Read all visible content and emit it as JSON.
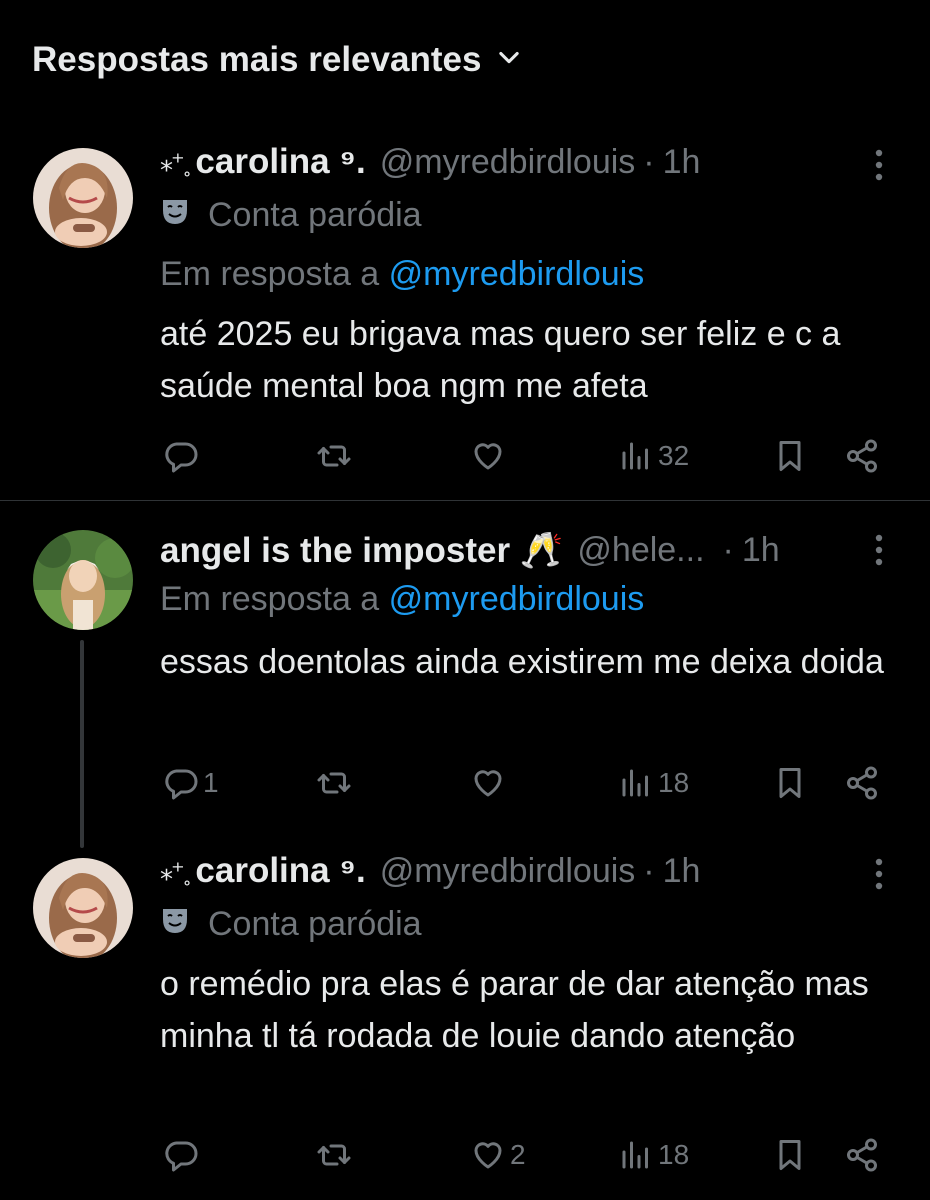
{
  "header": {
    "title": "Respostas mais relevantes"
  },
  "colors": {
    "background": "#000000",
    "text": "#e7e9ea",
    "muted": "#71767b",
    "link": "#1d9bf0",
    "divider": "#2f3336"
  },
  "tweets": [
    {
      "sparkle": "⁎⁺˳",
      "display_name": "carolina ⁹.",
      "handle": "@myredbirdlouis",
      "separator": "·",
      "time": "1h",
      "badge_icon": "theater-mask-icon",
      "badge_label": "Conta paródia",
      "reply_prefix": "Em resposta a",
      "reply_to": "@myredbirdlouis",
      "body": "até 2025 eu brigava mas quero ser feliz e c a saúde mental boa ngm me afeta",
      "replies": "",
      "retweets": "",
      "likes": "",
      "views": "32"
    },
    {
      "display_name": "angel is the imposter 🥂",
      "handle": "@hele...",
      "separator": "·",
      "time": "1h",
      "reply_prefix": "Em resposta a",
      "reply_to": "@myredbirdlouis",
      "body": "essas doentolas ainda existirem me deixa doida",
      "replies": "1",
      "retweets": "",
      "likes": "",
      "views": "18"
    },
    {
      "sparkle": "⁎⁺˳",
      "display_name": "carolina ⁹.",
      "handle": "@myredbirdlouis",
      "separator": "·",
      "time": "1h",
      "badge_icon": "theater-mask-icon",
      "badge_label": "Conta paródia",
      "body": "o remédio pra elas é parar de dar atenção mas minha tl tá rodada de louie dando atenção",
      "replies": "",
      "retweets": "",
      "likes": "2",
      "views": "18"
    }
  ]
}
